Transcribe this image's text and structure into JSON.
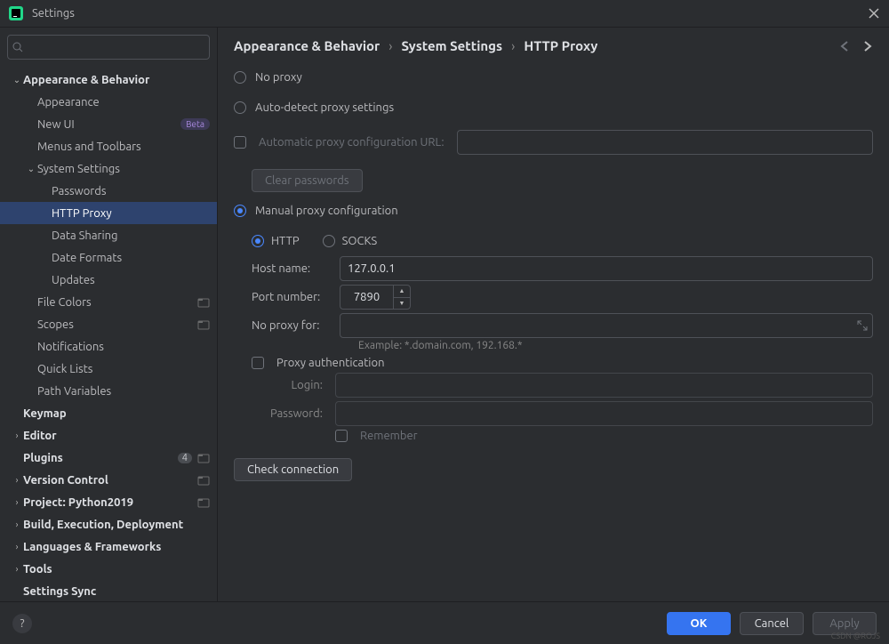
{
  "window": {
    "title": "Settings"
  },
  "search": {
    "placeholder": ""
  },
  "sidebar": {
    "items": [
      {
        "label": "Appearance & Behavior",
        "depth": 0,
        "expand": "down",
        "bold": true
      },
      {
        "label": "Appearance",
        "depth": 1
      },
      {
        "label": "New UI",
        "depth": 1,
        "badge": "Beta"
      },
      {
        "label": "Menus and Toolbars",
        "depth": 1
      },
      {
        "label": "System Settings",
        "depth": 1,
        "expand": "down"
      },
      {
        "label": "Passwords",
        "depth": 2
      },
      {
        "label": "HTTP Proxy",
        "depth": 2,
        "selected": true
      },
      {
        "label": "Data Sharing",
        "depth": 2
      },
      {
        "label": "Date Formats",
        "depth": 2
      },
      {
        "label": "Updates",
        "depth": 2
      },
      {
        "label": "File Colors",
        "depth": 1,
        "proj": true
      },
      {
        "label": "Scopes",
        "depth": 1,
        "proj": true
      },
      {
        "label": "Notifications",
        "depth": 1
      },
      {
        "label": "Quick Lists",
        "depth": 1
      },
      {
        "label": "Path Variables",
        "depth": 1
      },
      {
        "label": "Keymap",
        "depth": 0,
        "bold": true
      },
      {
        "label": "Editor",
        "depth": 0,
        "expand": "right",
        "bold": true
      },
      {
        "label": "Plugins",
        "depth": 0,
        "bold": true,
        "count": "4",
        "proj": true
      },
      {
        "label": "Version Control",
        "depth": 0,
        "expand": "right",
        "bold": true,
        "proj": true
      },
      {
        "label": "Project: Python2019",
        "depth": 0,
        "expand": "right",
        "bold": true,
        "proj": true
      },
      {
        "label": "Build, Execution, Deployment",
        "depth": 0,
        "expand": "right",
        "bold": true
      },
      {
        "label": "Languages & Frameworks",
        "depth": 0,
        "expand": "right",
        "bold": true
      },
      {
        "label": "Tools",
        "depth": 0,
        "expand": "right",
        "bold": true
      },
      {
        "label": "Settings Sync",
        "depth": 0,
        "bold": true
      }
    ]
  },
  "breadcrumb": {
    "a": "Appearance & Behavior",
    "b": "System Settings",
    "c": "HTTP Proxy"
  },
  "proxy": {
    "no_proxy": "No proxy",
    "auto_detect": "Auto-detect proxy settings",
    "auto_url": "Automatic proxy configuration URL:",
    "clear_passwords": "Clear passwords",
    "manual": "Manual proxy configuration",
    "http": "HTTP",
    "socks": "SOCKS",
    "host_label": "Host name:",
    "host_value": "127.0.0.1",
    "port_label": "Port number:",
    "port_value": "7890",
    "no_proxy_for_label": "No proxy for:",
    "no_proxy_for_value": "",
    "example": "Example: *.domain.com, 192.168.*",
    "proxy_auth": "Proxy authentication",
    "login_label": "Login:",
    "login_value": "",
    "password_label": "Password:",
    "password_value": "",
    "remember": "Remember",
    "check_connection": "Check connection"
  },
  "footer": {
    "ok": "OK",
    "cancel": "Cancel",
    "apply": "Apply"
  },
  "watermark": "CSDN @ROJS"
}
